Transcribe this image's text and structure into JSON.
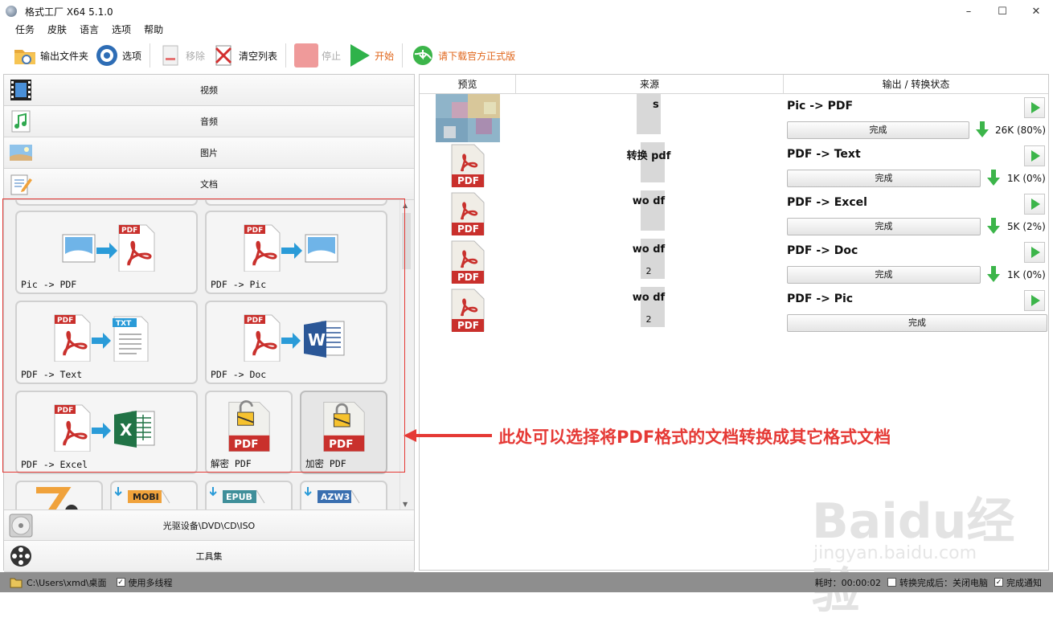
{
  "window": {
    "title": "格式工厂 X64 5.1.0"
  },
  "menu": [
    "任务",
    "皮肤",
    "语言",
    "选项",
    "帮助"
  ],
  "toolbar": {
    "output_folder": "输出文件夹",
    "options": "选项",
    "remove": "移除",
    "clear_list": "清空列表",
    "stop": "停止",
    "start": "开始",
    "download": "请下载官方正式版"
  },
  "categories": {
    "video": "视频",
    "audio": "音频",
    "picture": "图片",
    "document": "文档",
    "dvd": "光驱设备\\DVD\\CD\\ISO",
    "tools": "工具集"
  },
  "tiles": [
    {
      "label": "Pic -> PDF"
    },
    {
      "label": "PDF -> Pic"
    },
    {
      "label": "PDF -> Text"
    },
    {
      "label": "PDF -> Doc"
    },
    {
      "label": "PDF -> Excel"
    },
    {
      "label": "解密 PDF"
    },
    {
      "label": "加密 PDF"
    }
  ],
  "bottom_tiles": [
    {
      "badge": "MOBI"
    },
    {
      "badge": "EPUB"
    },
    {
      "badge": "AZW3"
    }
  ],
  "table": {
    "headers": [
      "预览",
      "来源",
      "输出 / 转换状态"
    ],
    "rows": [
      {
        "source": "s",
        "conv": "Pic -> PDF",
        "status": "完成",
        "size": "26K",
        "pct": "(80%)"
      },
      {
        "source": "转换 pdf",
        "conv": "PDF -> Text",
        "status": "完成",
        "size": "1K",
        "pct": "(0%)"
      },
      {
        "source": "wo df",
        "conv": "PDF -> Excel",
        "status": "完成",
        "size": "5K",
        "pct": "(2%)"
      },
      {
        "source": "wo df",
        "sub": "2",
        "conv": "PDF -> Doc",
        "status": "完成",
        "size": "1K",
        "pct": "(0%)"
      },
      {
        "source": "wo df",
        "sub": "2",
        "conv": "PDF -> Pic",
        "status": "完成"
      }
    ]
  },
  "pdf_badge": "PDF",
  "statusbar": {
    "path": "C:\\Users\\xmd\\桌面",
    "multithread": "使用多线程",
    "elapsed": "耗时：00:00:02",
    "after_done": "转换完成后：关闭电脑",
    "notify": "完成通知"
  },
  "annotation": "此处可以选择将PDF格式的文档转换成其它格式文档",
  "watermark": {
    "logo": "Baidu经验",
    "url": "jingyan.baidu.com"
  },
  "colors": {
    "accent": "#e53935",
    "pdf_red": "#c9302c",
    "green": "#3cb54a",
    "download_orange": "#e0661b"
  }
}
